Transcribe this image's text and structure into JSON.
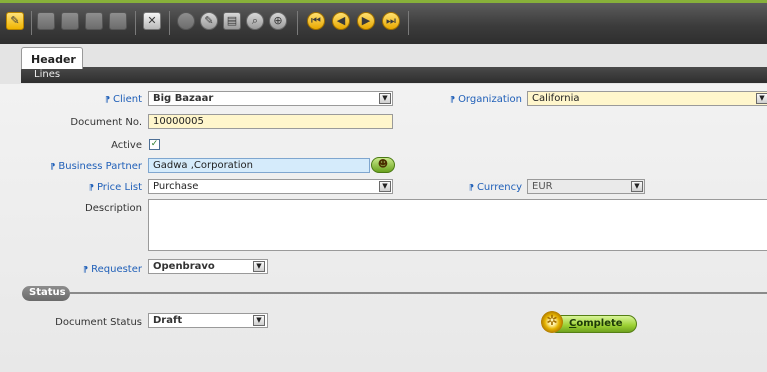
{
  "toolbar": {
    "icons": [
      "new-record-icon",
      "copy-icon",
      "paste-icon",
      "save-icon",
      "undo-icon",
      "delete-icon",
      "attach-icon",
      "edit-icon",
      "print-icon",
      "search-icon",
      "zoom-icon",
      "first-record-icon",
      "previous-record-icon",
      "next-record-icon",
      "last-record-icon"
    ]
  },
  "tabs": {
    "header": "Header",
    "lines": "Lines"
  },
  "form": {
    "client": {
      "label": "Client",
      "value": "Big Bazaar"
    },
    "organization": {
      "label": "Organization",
      "value": "California"
    },
    "document_no": {
      "label": "Document No.",
      "value": "10000005"
    },
    "active": {
      "label": "Active",
      "checked": true,
      "mark": "✓"
    },
    "business_partner": {
      "label": "Business Partner",
      "value": "Gadwa ,Corporation"
    },
    "price_list": {
      "label": "Price List",
      "value": "Purchase"
    },
    "currency": {
      "label": "Currency",
      "value": "EUR"
    },
    "description": {
      "label": "Description",
      "value": ""
    },
    "requester": {
      "label": "Requester",
      "value": "Openbravo"
    }
  },
  "status_section": {
    "title": "Status",
    "document_status": {
      "label": "Document Status",
      "value": "Draft"
    },
    "complete_button": "Complete"
  },
  "glyphs": {
    "link": "⁋",
    "dropdown": "▼"
  },
  "colors": {
    "accent": "#88b13a",
    "required": "#fff6cc",
    "partner_field": "#d5ebfb",
    "link": "#1f5fb8"
  }
}
